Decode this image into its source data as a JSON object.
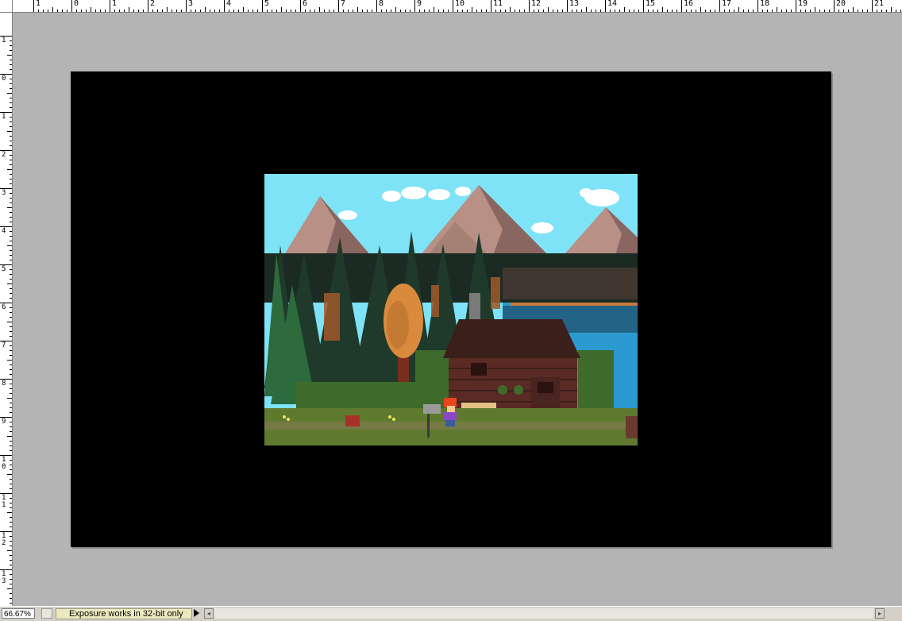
{
  "rulers": {
    "top_labels": [
      "1",
      "0",
      "1",
      "2",
      "3",
      "4",
      "5",
      "6",
      "7",
      "8",
      "9",
      "10",
      "11",
      "12",
      "13",
      "14",
      "15",
      "16",
      "17",
      "18",
      "19",
      "20",
      "21"
    ],
    "left_labels": [
      "1",
      "0",
      "1",
      "2",
      "3",
      "4",
      "5",
      "6",
      "7",
      "8",
      "9",
      "10",
      "11",
      "12",
      "13"
    ]
  },
  "statusbar": {
    "zoom": "66.67%",
    "message": "Exposure works in 32-bit only"
  },
  "document": {
    "background": "#000000",
    "workspace_color": "#b4b4b4"
  },
  "scene": {
    "description_icons": [
      "mountains",
      "pine-forest",
      "autumn-tree",
      "log-cabin",
      "lake",
      "red-haired-character",
      "mailbox",
      "tree-stump"
    ]
  }
}
